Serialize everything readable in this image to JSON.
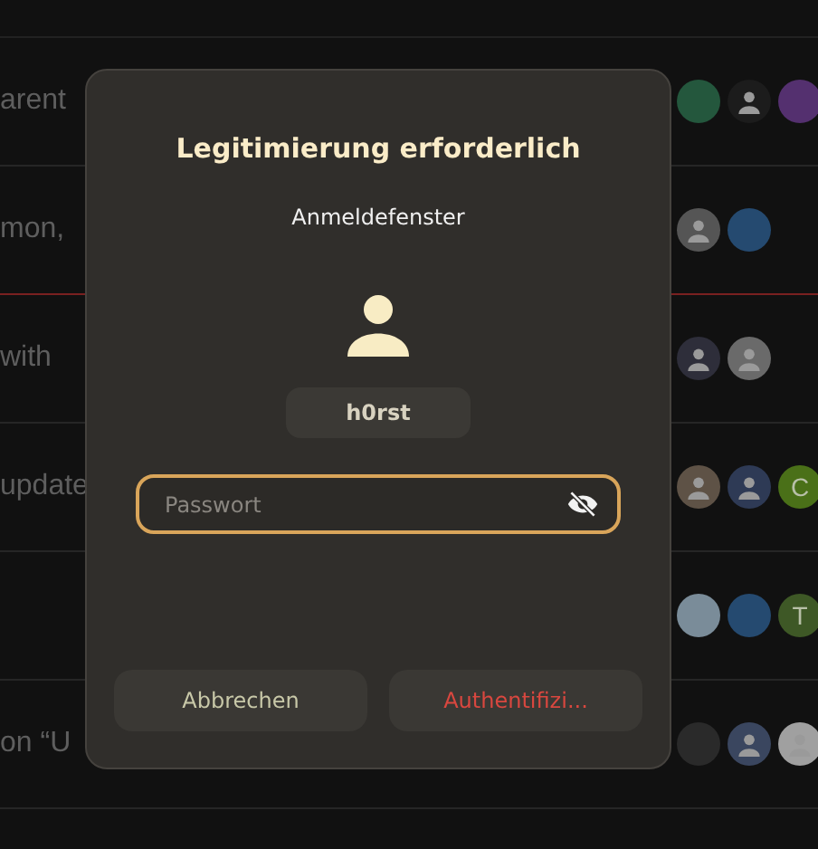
{
  "topics": [
    {
      "title": "arent",
      "last_read": false,
      "avatars": [
        {
          "color": "#24573d"
        },
        {
          "color": "#1c1c1c",
          "kind": "picture"
        },
        {
          "color": "#54306f"
        }
      ]
    },
    {
      "title": "mon,",
      "last_read": true,
      "avatars": [
        {
          "color": "#555555",
          "kind": "picture"
        },
        {
          "color": "#254a70"
        }
      ]
    },
    {
      "title": "with",
      "last_read": false,
      "avatars": [
        {
          "color": "#2e2e3a",
          "kind": "picture"
        },
        {
          "color": "#6a6a6a",
          "kind": "picture"
        }
      ]
    },
    {
      "title": "update",
      "last_read": false,
      "avatars": [
        {
          "color": "#5e5246",
          "kind": "picture"
        },
        {
          "color": "#2e3a55",
          "kind": "picture"
        },
        {
          "color": "#4a7018",
          "letter": "C"
        }
      ]
    },
    {
      "last_read": false,
      "avatars": [
        {
          "color": "#7a8c99"
        },
        {
          "color": "#254a70"
        },
        {
          "color": "#3e5826",
          "letter": "T"
        }
      ]
    },
    {
      "title": "on “U",
      "last_read": false,
      "avatars": [
        {
          "color": "#2a2a2a"
        },
        {
          "color": "#3a465f",
          "kind": "picture"
        },
        {
          "color": "#a0a0a0",
          "kind": "picture"
        }
      ]
    }
  ],
  "dialog": {
    "title": "Legitimierung erforderlich",
    "subtitle": "Anmeldefenster",
    "user": "h0rst",
    "password": {
      "placeholder": "Passwort",
      "focused": true
    },
    "buttons": [
      {
        "label": "Abbrechen",
        "kind": "cancel"
      },
      {
        "label": "Authentifizi...",
        "kind": "destructive"
      }
    ]
  }
}
